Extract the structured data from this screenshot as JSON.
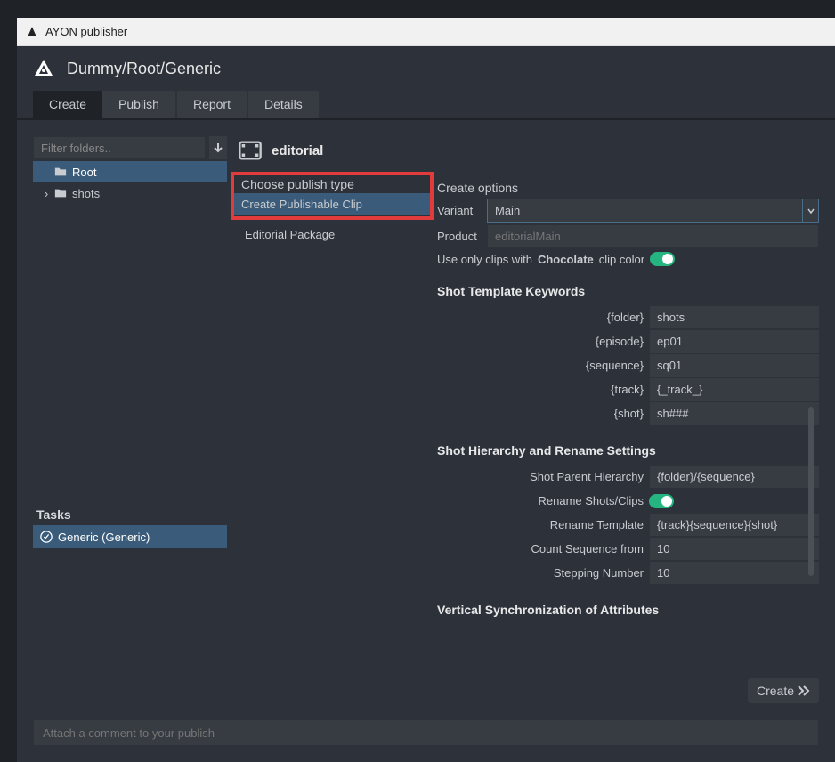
{
  "app_title": "AYON publisher",
  "breadcrumb": "Dummy/Root/Generic",
  "tabs": [
    "Create",
    "Publish",
    "Report",
    "Details"
  ],
  "active_tab": "Create",
  "left": {
    "filter_placeholder": "Filter folders..",
    "tree": [
      {
        "label": "Root",
        "selected": true,
        "has_children": false
      },
      {
        "label": "shots",
        "selected": false,
        "has_children": true
      }
    ],
    "tasks_label": "Tasks",
    "tasks": [
      "Generic (Generic)"
    ]
  },
  "middle": {
    "title": "editorial",
    "choose_label": "Choose publish type",
    "types": [
      "Create Publishable Clip",
      "Editorial Package"
    ],
    "selected_type": "Create Publishable Clip"
  },
  "right": {
    "create_options_label": "Create options",
    "variant_label": "Variant",
    "variant_value": "Main",
    "product_label": "Product",
    "product_value": "editorialMain",
    "clip_color_prefix": "Use only clips with",
    "clip_color_name": "Chocolate",
    "clip_color_suffix": "clip color",
    "section_shot_template": "Shot Template Keywords",
    "shot_template": [
      {
        "k": "{folder}",
        "v": "shots"
      },
      {
        "k": "{episode}",
        "v": "ep01"
      },
      {
        "k": "{sequence}",
        "v": "sq01"
      },
      {
        "k": "{track}",
        "v": "{_track_}"
      },
      {
        "k": "{shot}",
        "v": "sh###"
      }
    ],
    "section_hierarchy": "Shot Hierarchy and Rename Settings",
    "hierarchy_rows": [
      {
        "k": "Shot Parent Hierarchy",
        "v": "{folder}/{sequence}",
        "type": "text"
      },
      {
        "k": "Rename Shots/Clips",
        "v": "",
        "type": "toggle"
      },
      {
        "k": "Rename Template",
        "v": "{track}{sequence}{shot}",
        "type": "text"
      },
      {
        "k": "Count Sequence from",
        "v": "10",
        "type": "text"
      },
      {
        "k": "Stepping Number",
        "v": "10",
        "type": "text"
      }
    ],
    "section_vertical": "Vertical Synchronization of Attributes"
  },
  "create_button": "Create",
  "comment_placeholder": "Attach a comment to your publish"
}
